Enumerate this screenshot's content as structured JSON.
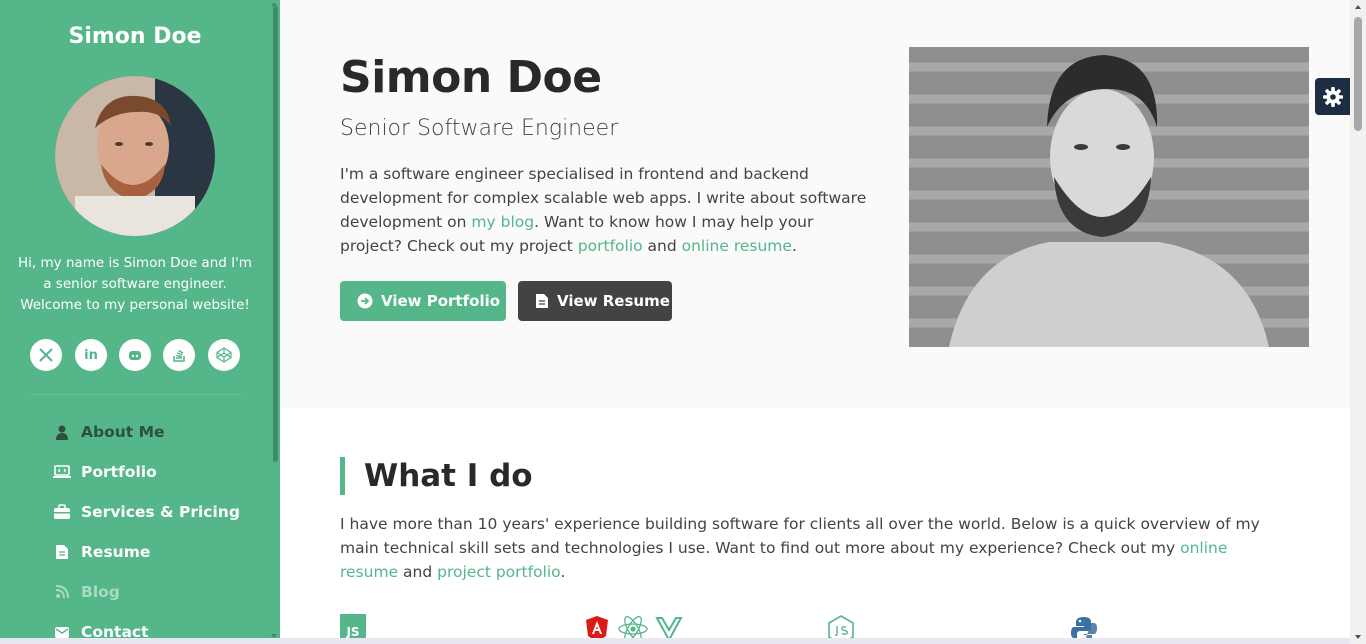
{
  "sidebar": {
    "name": "Simon Doe",
    "bio": "Hi, my name is Simon Doe and I'm a senior software engineer. Welcome to my personal website!",
    "socials": [
      {
        "icon": "x-twitter-icon",
        "glyph": "𝕏"
      },
      {
        "icon": "linkedin-icon",
        "glyph": "in"
      },
      {
        "icon": "github-icon",
        "glyph": "⌂"
      },
      {
        "icon": "stack-overflow-icon",
        "glyph": "≡"
      },
      {
        "icon": "codepen-icon",
        "glyph": "◇"
      }
    ],
    "nav": [
      {
        "label": "About Me",
        "icon": "user-icon",
        "state": "active"
      },
      {
        "label": "Portfolio",
        "icon": "laptop-code-icon",
        "state": "normal"
      },
      {
        "label": "Services & Pricing",
        "icon": "briefcase-icon",
        "state": "normal"
      },
      {
        "label": "Resume",
        "icon": "file-icon",
        "state": "normal"
      },
      {
        "label": "Blog",
        "icon": "blog-icon",
        "state": "dim"
      },
      {
        "label": "Contact",
        "icon": "envelope-icon",
        "state": "normal"
      }
    ]
  },
  "hero": {
    "name": "Simon Doe",
    "title": "Senior Software Engineer",
    "intro_1": "I'm a software engineer specialised in frontend and backend development for complex scalable web apps. I write about software development on ",
    "link_blog": "my blog",
    "intro_2": ". Want to know how I may help your project? Check out my project ",
    "link_portfolio": "portfolio",
    "intro_3": " and ",
    "link_resume": "online resume",
    "intro_4": ".",
    "btn_portfolio": "View Portfolio",
    "btn_resume": "View Resume"
  },
  "what_i_do": {
    "title": "What I do",
    "text_1": "I have more than 10 years' experience building software for clients all over the world. Below is a quick overview of my main technical skill sets and technologies I use. Want to find out more about my experience? Check out my ",
    "link_resume": "online resume",
    "text_2": " and ",
    "link_portfolio": "project portfolio",
    "text_3": ".",
    "tech_js_label": "JS"
  },
  "colors": {
    "accent": "#54b689",
    "dark": "#434343",
    "settings_bg": "#1d2d44"
  }
}
